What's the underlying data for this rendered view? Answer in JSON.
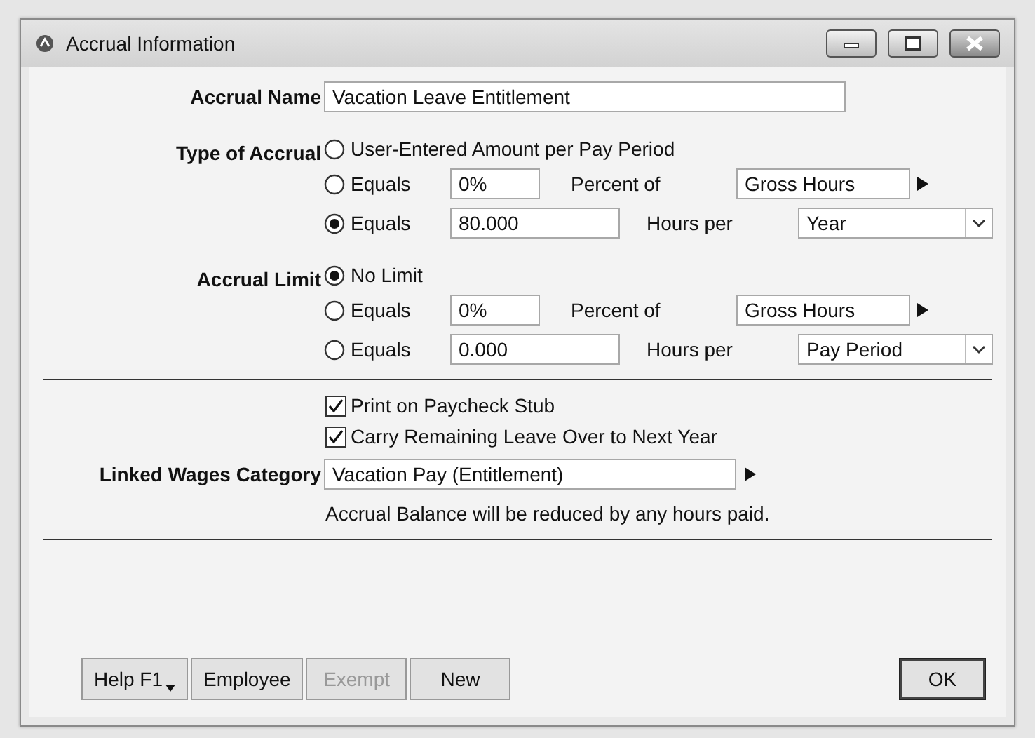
{
  "window": {
    "title": "Accrual Information"
  },
  "accrual_name": {
    "label": "Accrual Name",
    "value": "Vacation Leave Entitlement"
  },
  "type_of_accrual": {
    "label": "Type of Accrual",
    "options": [
      {
        "kind": "plain",
        "label": "User-Entered Amount per Pay Period",
        "selected": false
      },
      {
        "kind": "percent",
        "label": "Equals",
        "selected": false,
        "value": "0%",
        "unit_label": "Percent of",
        "basis": "Gross Hours"
      },
      {
        "kind": "hours",
        "label": "Equals",
        "selected": true,
        "value": "80.000",
        "unit_label": "Hours per",
        "period": "Year"
      }
    ]
  },
  "accrual_limit": {
    "label": "Accrual Limit",
    "options": [
      {
        "kind": "plain",
        "label": "No Limit",
        "selected": true
      },
      {
        "kind": "percent",
        "label": "Equals",
        "selected": false,
        "value": "0%",
        "unit_label": "Percent of",
        "basis": "Gross Hours"
      },
      {
        "kind": "hours",
        "label": "Equals",
        "selected": false,
        "value": "0.000",
        "unit_label": "Hours per",
        "period": "Pay Period"
      }
    ]
  },
  "checkboxes": [
    {
      "label": "Print on Paycheck Stub",
      "checked": true
    },
    {
      "label": "Carry Remaining Leave Over to Next Year",
      "checked": true
    }
  ],
  "linked_wages": {
    "label": "Linked Wages Category",
    "value": "Vacation Pay (Entitlement)",
    "note": "Accrual Balance will be reduced by any hours paid."
  },
  "buttons": [
    {
      "label": "Help F1",
      "kind": "menu",
      "disabled": false
    },
    {
      "label": "Employee",
      "kind": "plain",
      "disabled": false
    },
    {
      "label": "Exempt",
      "kind": "plain",
      "disabled": true
    },
    {
      "label": "New",
      "kind": "plain",
      "disabled": false
    },
    {
      "label": "OK",
      "kind": "default",
      "disabled": false
    }
  ]
}
